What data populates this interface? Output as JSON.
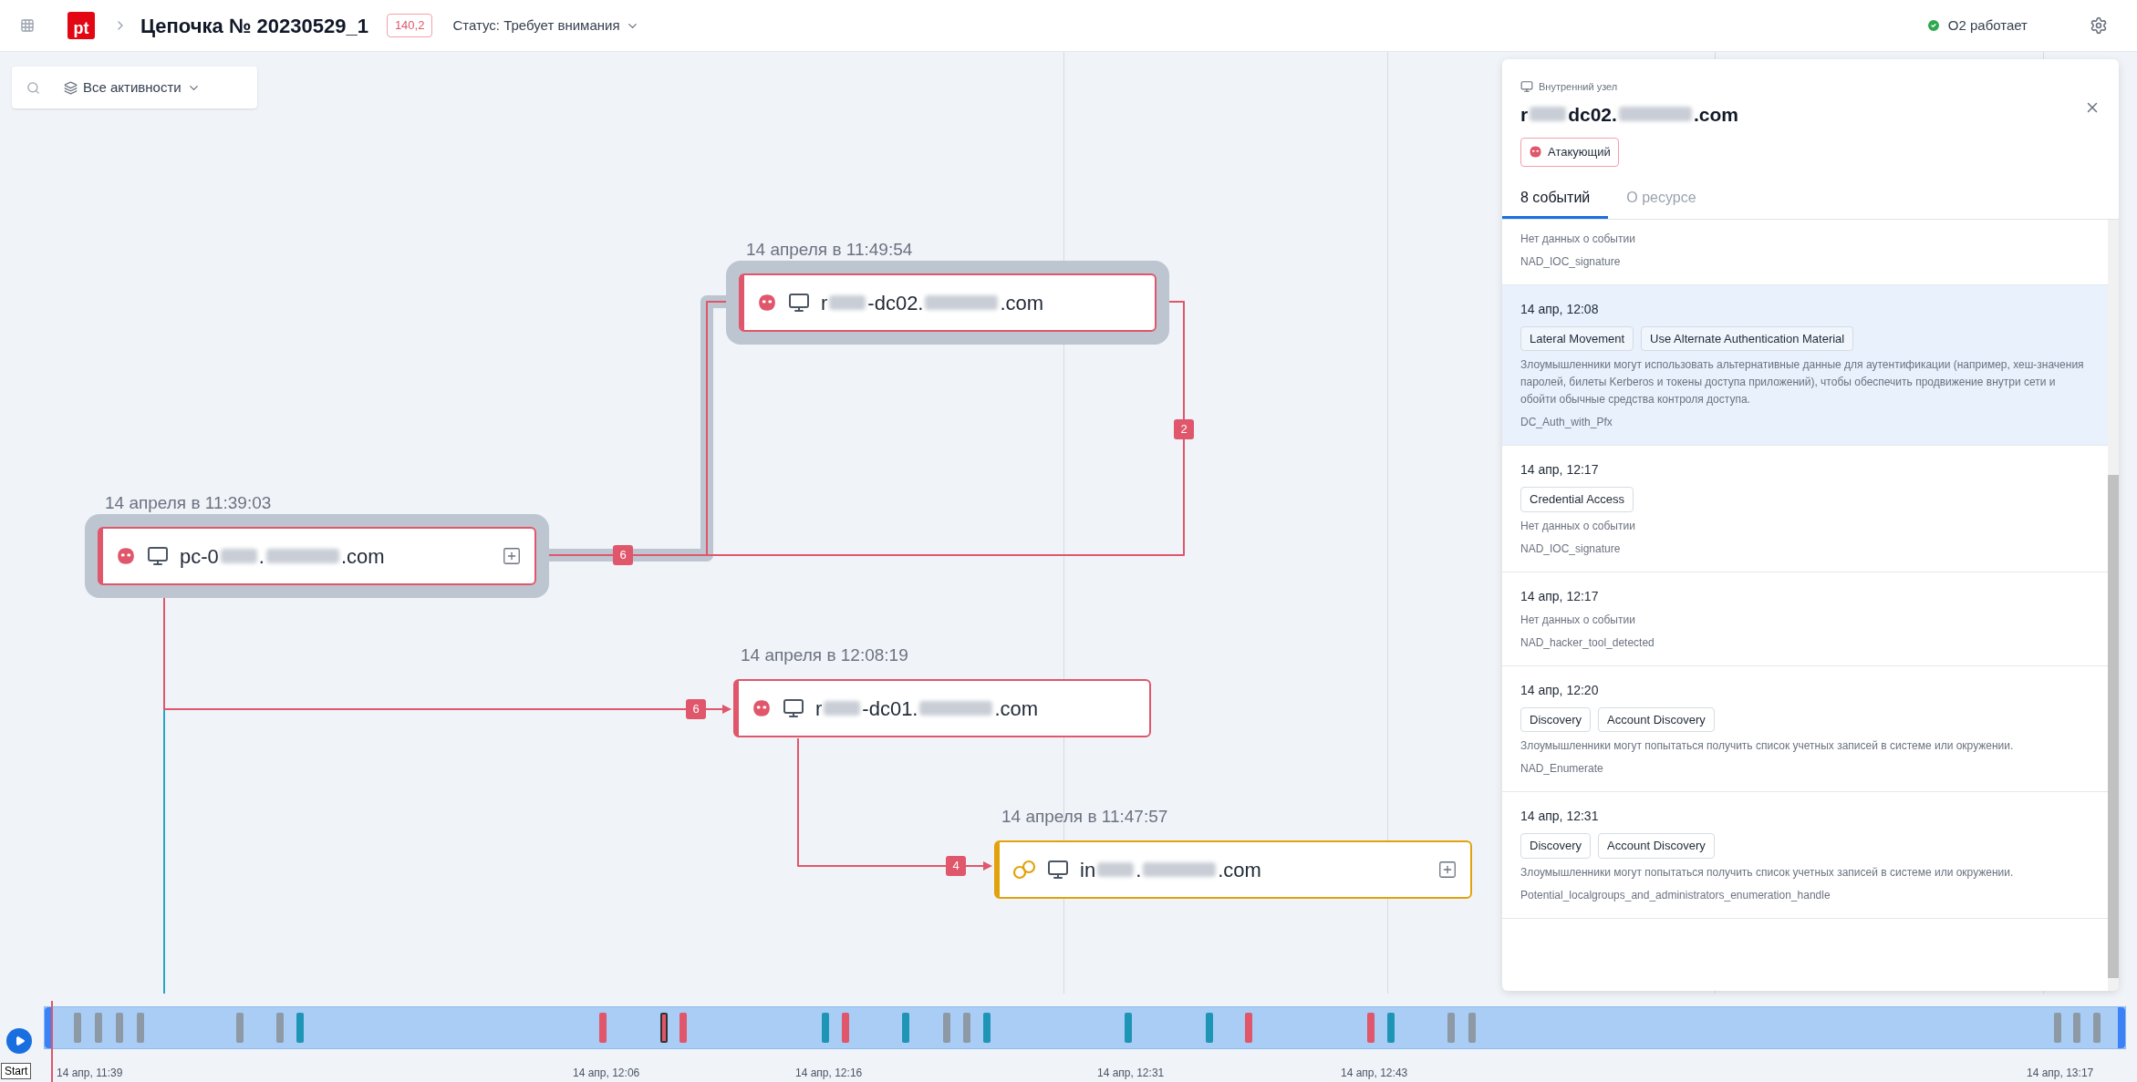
{
  "topbar": {
    "logo": "pt",
    "title": "Цепочка № 20230529_1",
    "score": "140,2",
    "status": "Статус: Требует внимания",
    "service_status": "O2 работает"
  },
  "toolbar": {
    "filter": "Все активности"
  },
  "nodes": [
    {
      "time": "14 апреля в 11:39:03",
      "name": [
        "pc-0",
        ".",
        ".com"
      ],
      "kind": "attacker",
      "highlighted": true,
      "expandable": true
    },
    {
      "time": "14 апреля в 11:49:54",
      "name": [
        "r",
        "-dc02.",
        ".com"
      ],
      "kind": "attacker",
      "highlighted": true,
      "expandable": false
    },
    {
      "time": "14 апреля в 12:08:19",
      "name": [
        "r",
        "-dc01.",
        ".com"
      ],
      "kind": "attacker",
      "highlighted": false,
      "expandable": false
    },
    {
      "time": "14 апреля в 11:47:57",
      "name": [
        "in",
        ".",
        ".com"
      ],
      "kind": "captured",
      "highlighted": false,
      "expandable": true
    }
  ],
  "edges": [
    {
      "count": "6",
      "highlighted": true
    },
    {
      "count": "2",
      "highlighted": false
    },
    {
      "count": "6",
      "highlighted": false
    },
    {
      "count": "4",
      "highlighted": false
    }
  ],
  "panel": {
    "type_label": "Внутренний узел",
    "title": [
      "r",
      "dc02.",
      ".com"
    ],
    "role": "Атакующий",
    "tabs": [
      {
        "label": "8 событий",
        "selected": true
      },
      {
        "label": "О ресурсе",
        "selected": false
      }
    ],
    "events": [
      {
        "description": "Нет данных о событии",
        "rule": "NAD_IOC_signature",
        "selected": false
      },
      {
        "date": "14 апр, 12:08",
        "tags": [
          "Lateral Movement",
          "Use Alternate Authentication Material"
        ],
        "description": "Злоумышленники могут использовать альтернативные данные для аутентификации (например, хеш-значения паролей, билеты Kerberos и токены доступа приложений), чтобы обеспечить продвижение внутри сети и обойти обычные средства контроля доступа.",
        "rule": "DC_Auth_with_Pfx",
        "selected": true
      },
      {
        "date": "14 апр, 12:17",
        "tags": [
          "Credential Access"
        ],
        "description": "Нет данных о событии",
        "rule": "NAD_IOC_signature",
        "selected": false
      },
      {
        "date": "14 апр, 12:17",
        "description": "Нет данных о событии",
        "rule": "NAD_hacker_tool_detected",
        "selected": false
      },
      {
        "date": "14 апр, 12:20",
        "tags": [
          "Discovery",
          "Account Discovery"
        ],
        "description": "Злоумышленники могут попытаться получить список учетных записей в системе или окружении.",
        "rule": "NAD_Enumerate",
        "selected": false
      },
      {
        "date": "14 апр, 12:31",
        "tags": [
          "Discovery",
          "Account Discovery"
        ],
        "description": "Злоумышленники могут попытаться получить список учетных записей в системе или окружении.",
        "rule": "Potential_localgroups_and_administrators_enumeration_handle",
        "selected": false
      }
    ]
  },
  "timeline": {
    "start": "Start",
    "ticks": [
      "14 апр, 11:39",
      "14 апр, 12:06",
      "14 апр, 12:16",
      "14 апр, 12:31",
      "14 апр, 12:43",
      "14 апр, 13:17"
    ]
  }
}
